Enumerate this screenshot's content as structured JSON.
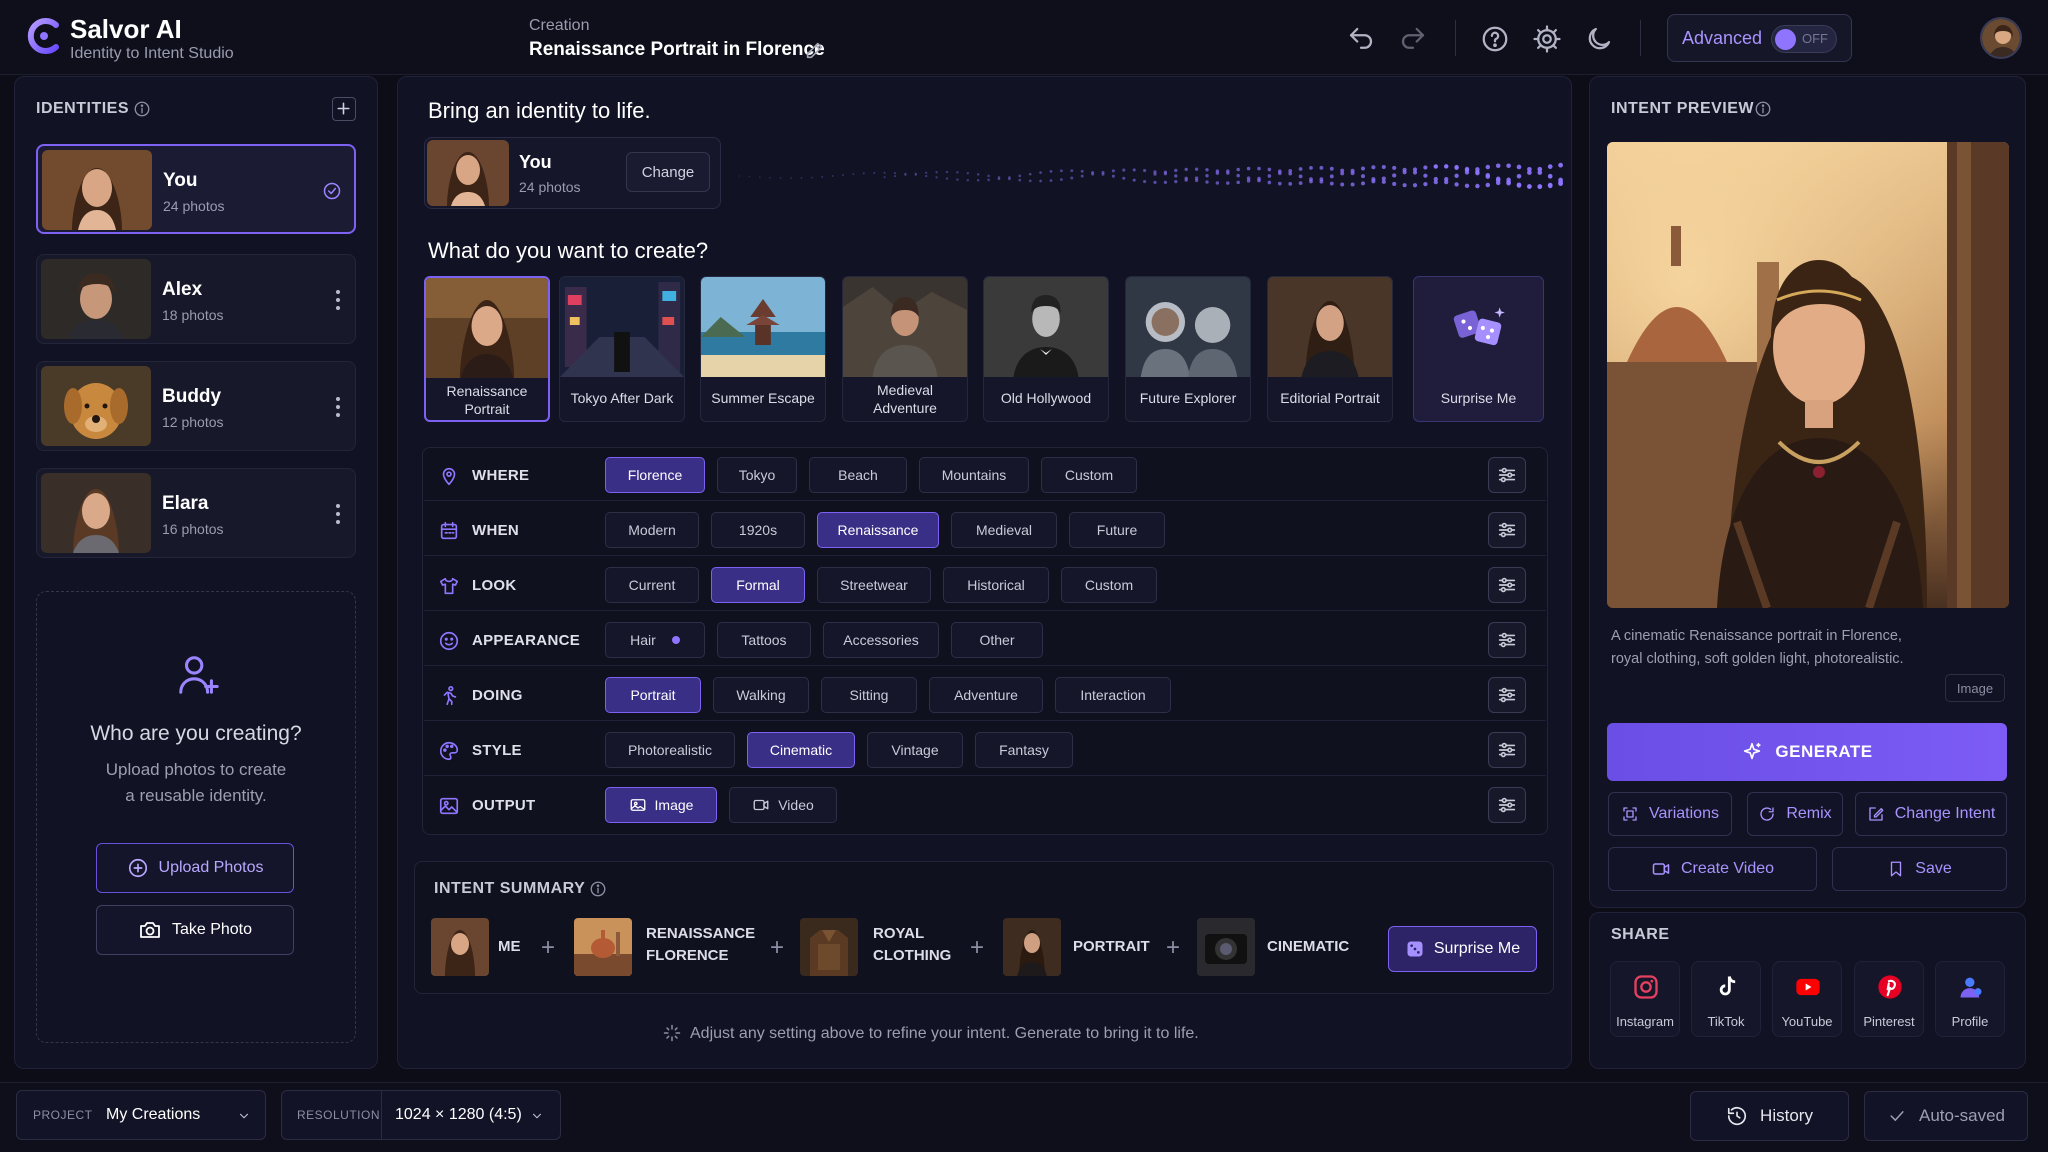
{
  "app": {
    "name": "Salvor AI",
    "tagline": "Identity to Intent Studio"
  },
  "header": {
    "crumb_label": "Creation",
    "title": "Renaissance Portrait in Florence",
    "advanced_label": "Advanced",
    "advanced_toggle": "OFF",
    "advanced_on": false
  },
  "identities": {
    "title": "IDENTITIES",
    "items": [
      {
        "name": "You",
        "photos": "24 photos",
        "selected": true
      },
      {
        "name": "Alex",
        "photos": "18 photos",
        "selected": false
      },
      {
        "name": "Buddy",
        "photos": "12 photos",
        "selected": false
      },
      {
        "name": "Elara",
        "photos": "16 photos",
        "selected": false
      }
    ],
    "create_title": "Who are you creating?",
    "create_desc_1": "Upload photos to create",
    "create_desc_2": "a reusable identity.",
    "upload_label": "Upload Photos",
    "take_photo_label": "Take Photo"
  },
  "main": {
    "heading": "Bring an identity to life.",
    "current_identity": {
      "name": "You",
      "photos": "24 photos",
      "change_label": "Change"
    },
    "create_heading": "What do you want to create?",
    "styles": [
      {
        "line1": "Renaissance",
        "line2": "Portrait",
        "selected": true
      },
      {
        "line1": "Tokyo After Dark",
        "line2": "",
        "selected": false
      },
      {
        "line1": "Summer Escape",
        "line2": "",
        "selected": false
      },
      {
        "line1": "Medieval",
        "line2": "Adventure",
        "selected": false
      },
      {
        "line1": "Old Hollywood",
        "line2": "",
        "selected": false
      },
      {
        "line1": "Future Explorer",
        "line2": "",
        "selected": false
      },
      {
        "line1": "Editorial Portrait",
        "line2": "",
        "selected": false
      },
      {
        "line1": "Surprise Me",
        "line2": "",
        "selected": false
      }
    ],
    "rows": [
      {
        "label": "WHERE",
        "icon": "location-pin-icon",
        "options": [
          "Florence",
          "Tokyo",
          "Beach",
          "Mountains",
          "Custom"
        ],
        "selected": 0
      },
      {
        "label": "WHEN",
        "icon": "calendar-icon",
        "options": [
          "Modern",
          "1920s",
          "Renaissance",
          "Medieval",
          "Future"
        ],
        "selected": 2
      },
      {
        "label": "LOOK",
        "icon": "shirt-icon",
        "options": [
          "Current",
          "Formal",
          "Streetwear",
          "Historical",
          "Custom"
        ],
        "selected": 1
      },
      {
        "label": "APPEARANCE",
        "icon": "face-icon",
        "options": [
          "Hair",
          "Tattoos",
          "Accessories",
          "Other"
        ],
        "selected": -1
      },
      {
        "label": "DOING",
        "icon": "running-person-icon",
        "options": [
          "Portrait",
          "Walking",
          "Sitting",
          "Adventure",
          "Interaction"
        ],
        "selected": 0
      },
      {
        "label": "STYLE",
        "icon": "palette-icon",
        "options": [
          "Photorealistic",
          "Cinematic",
          "Vintage",
          "Fantasy"
        ],
        "selected": 1
      },
      {
        "label": "OUTPUT",
        "icon": "image-frame-icon",
        "options": [
          "Image",
          "Video"
        ],
        "selected": 0
      }
    ],
    "summary": {
      "title": "INTENT SUMMARY",
      "items": [
        {
          "line1": "ME",
          "line2": ""
        },
        {
          "line1": "RENAISSANCE",
          "line2": "FLORENCE"
        },
        {
          "line1": "ROYAL",
          "line2": "CLOTHING"
        },
        {
          "line1": "PORTRAIT",
          "line2": ""
        },
        {
          "line1": "CINEMATIC",
          "line2": ""
        }
      ],
      "surprise_label": "Surprise Me"
    },
    "hint": "Adjust any setting above to refine your intent. Generate to bring it to life."
  },
  "preview": {
    "title": "INTENT PREVIEW",
    "desc_1": "A cinematic Renaissance portrait in Florence,",
    "desc_2": "royal clothing, soft golden light, photorealistic.",
    "badge": "Image",
    "generate_label": "GENERATE",
    "variations_label": "Variations",
    "remix_label": "Remix",
    "change_intent_label": "Change Intent",
    "create_video_label": "Create Video",
    "save_label": "Save"
  },
  "share": {
    "title": "SHARE",
    "items": [
      {
        "label": "Instagram",
        "icon": "instagram-icon",
        "color": "#e4405f"
      },
      {
        "label": "TikTok",
        "icon": "tiktok-icon",
        "color": "#ffffff"
      },
      {
        "label": "YouTube",
        "icon": "youtube-icon",
        "color": "#ff0000"
      },
      {
        "label": "Pinterest",
        "icon": "pinterest-icon",
        "color": "#e60023"
      },
      {
        "label": "Profile",
        "icon": "profile-icon",
        "color": "#7c61f2"
      }
    ]
  },
  "bottom": {
    "project_label": "PROJECT",
    "project_value": "My Creations",
    "resolution_label": "RESOLUTION",
    "resolution_value": "1024 × 1280 (4:5)",
    "history_label": "History",
    "autosave_label": "Auto-saved"
  },
  "colors": {
    "accent": "#7c61f2",
    "accent_bg": "#3a2f86",
    "panel": "#111223",
    "background": "#0c0d17"
  }
}
